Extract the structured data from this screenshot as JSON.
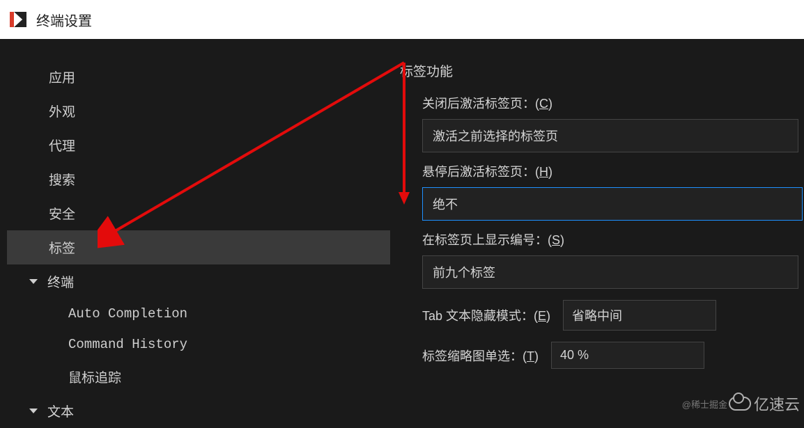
{
  "window": {
    "title": "终端设置"
  },
  "sidebar": {
    "items": [
      {
        "label": "应用"
      },
      {
        "label": "外观"
      },
      {
        "label": "代理"
      },
      {
        "label": "搜索"
      },
      {
        "label": "安全"
      },
      {
        "label": "标签",
        "active": true
      }
    ],
    "group1": {
      "label": "终端",
      "children": [
        {
          "label": "Auto Completion"
        },
        {
          "label": "Command History"
        },
        {
          "label": "鼠标追踪"
        }
      ]
    },
    "group2": {
      "label": "文本"
    }
  },
  "main": {
    "section_title": "标签功能",
    "close_activate": {
      "label_prefix": "关闭后激活标签页：(",
      "hotkey": "C",
      "label_suffix": ")",
      "value": "激活之前选择的标签页"
    },
    "hover_activate": {
      "label_prefix": "悬停后激活标签页：(",
      "hotkey": "H",
      "label_suffix": ")",
      "value": "绝不"
    },
    "show_number": {
      "label_prefix": "在标签页上显示编号：(",
      "hotkey": "S",
      "label_suffix": ")",
      "value": "前九个标签"
    },
    "hide_mode": {
      "label_prefix": "Tab 文本隐藏模式：(",
      "hotkey": "E",
      "label_suffix": ")",
      "value": "省略中间"
    },
    "thumbnail": {
      "label_prefix": "标签缩略图单选：(",
      "hotkey": "T",
      "label_suffix": ")",
      "value": "40 %"
    }
  },
  "watermarks": {
    "juejin": "@稀士掘金",
    "yisu": "亿速云"
  }
}
